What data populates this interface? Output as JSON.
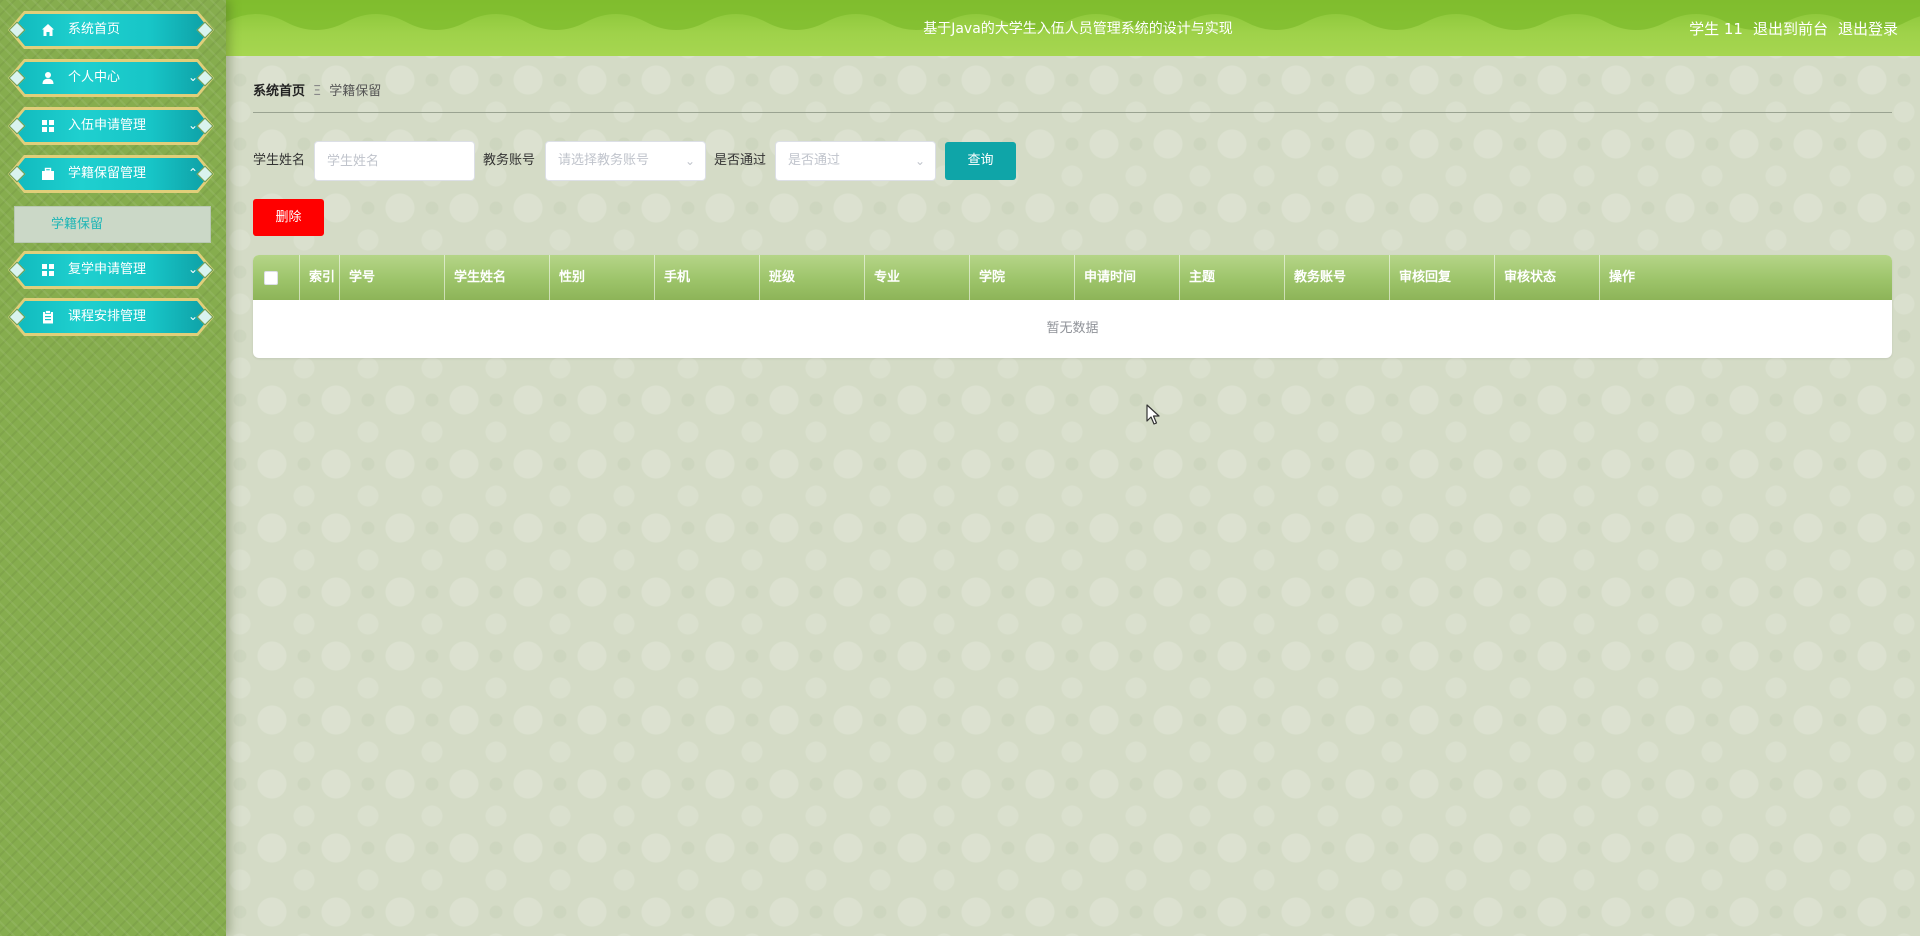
{
  "header": {
    "title": "基于Java的大学生入伍人员管理系统的设计与实现",
    "user": "学生 11",
    "back_to_front": "退出到前台",
    "logout": "退出登录"
  },
  "sidebar": {
    "items": [
      {
        "label": "系统首页",
        "icon": "home-icon"
      },
      {
        "label": "个人中心",
        "icon": "user-icon"
      },
      {
        "label": "入伍申请管理",
        "icon": "grid-icon"
      },
      {
        "label": "学籍保留管理",
        "icon": "briefcase-icon"
      },
      {
        "label": "复学申请管理",
        "icon": "grid-icon"
      },
      {
        "label": "课程安排管理",
        "icon": "clipboard-icon"
      }
    ],
    "active_sub": "学籍保留"
  },
  "breadcrumb": {
    "home": "系统首页",
    "separator": "Ξ",
    "current": "学籍保留"
  },
  "search": {
    "name_label": "学生姓名",
    "name_placeholder": "学生姓名",
    "account_label": "教务账号",
    "account_placeholder": "请选择教务账号",
    "pass_label": "是否通过",
    "pass_placeholder": "是否通过",
    "query_button": "查询"
  },
  "actions": {
    "delete_button": "删除"
  },
  "table": {
    "columns": [
      "索引",
      "学号",
      "学生姓名",
      "性别",
      "手机",
      "班级",
      "专业",
      "学院",
      "申请时间",
      "主题",
      "教务账号",
      "审核回复",
      "审核状态",
      "操作"
    ],
    "empty_text": "暂无数据"
  },
  "colors": {
    "accent": "#0fa5a8",
    "danger": "#ff0000",
    "topbar": "#9fd24a",
    "sidebar": "#86ad4e"
  }
}
